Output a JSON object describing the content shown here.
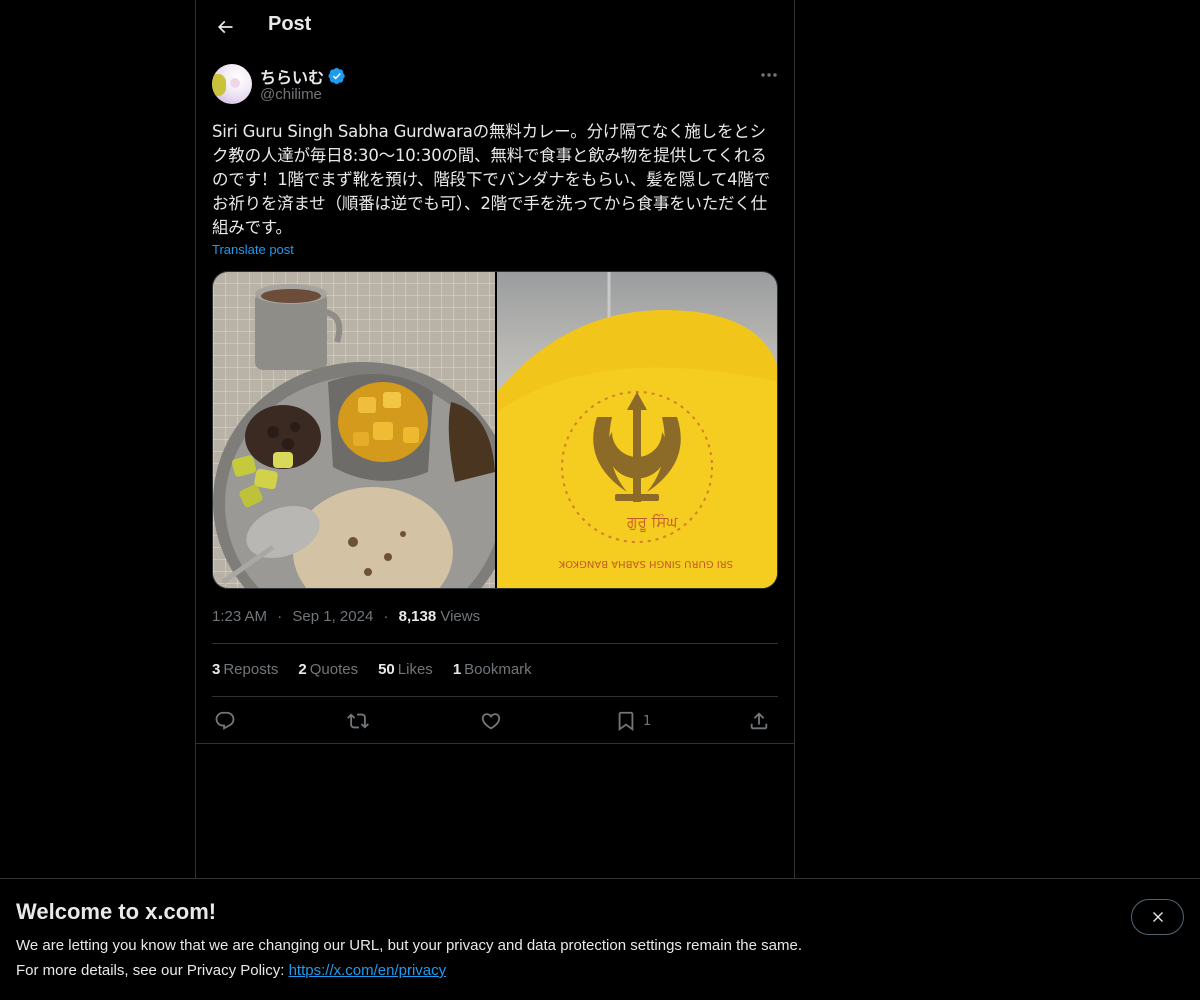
{
  "header": {
    "title": "Post"
  },
  "author": {
    "display_name": "ちらいむ",
    "handle": "@chilime",
    "verified": true
  },
  "post": {
    "text": "Siri Guru Singh Sabha Gurdwaraの無料カレー。分け隔てなく施しをとシク教の人達が毎日8:30〜10:30の間、無料で食事と飲み物を提供してくれるのです！1階でまず靴を預け、階段下でバンダナをもらい、髪を隠して4階でお祈りを済ませ（順番は逆でも可）、2階で手を洗ってから食事をいただく仕組みです。",
    "translate_label": "Translate post",
    "media_text": [
      "ਗੁਰੂ ਸਿੰਘ",
      "SRI GURU SINGH SABHA BANGKOK"
    ]
  },
  "meta": {
    "time": "1:23 AM",
    "date": "Sep 1, 2024",
    "views_count": "8,138",
    "views_label": "Views",
    "separator": "·"
  },
  "stats": [
    {
      "count": "3",
      "label": "Reposts"
    },
    {
      "count": "2",
      "label": "Quotes"
    },
    {
      "count": "50",
      "label": "Likes"
    },
    {
      "count": "1",
      "label": "Bookmark"
    }
  ],
  "actions": {
    "bookmark_count": "1"
  },
  "banner": {
    "title": "Welcome to x.com!",
    "line1": "We are letting you know that we are changing our URL, but your privacy and data protection settings remain the same.",
    "line2_prefix": "For more details, see our Privacy Policy: ",
    "link_text": "https://x.com/en/privacy"
  },
  "colors": {
    "accent": "#1d9bf0",
    "background": "#000000",
    "text": "#e7e9ea",
    "muted": "#71767b",
    "border": "#2f3336"
  },
  "icons": [
    "back-arrow-icon",
    "verified-badge-icon",
    "more-icon",
    "reply-icon",
    "repost-icon",
    "like-icon",
    "bookmark-icon",
    "share-icon",
    "close-icon"
  ]
}
